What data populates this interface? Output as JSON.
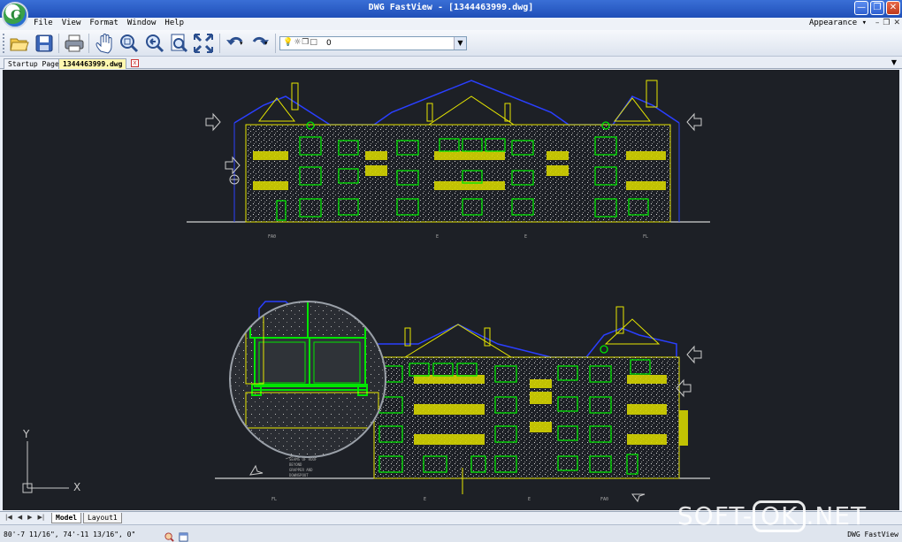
{
  "window": {
    "title": "DWG FastView - [1344463999.dwg]",
    "minimize_icon": "minimize-icon",
    "maximize_icon": "restore-icon",
    "close_icon": "close-icon"
  },
  "menu": {
    "items": [
      "File",
      "View",
      "Format",
      "Window",
      "Help"
    ],
    "appearance": "Appearance ▾"
  },
  "toolbar": {
    "tools": [
      "open-icon",
      "save-icon",
      "print-icon",
      "pan-icon",
      "zoom-window-icon",
      "zoom-previous-icon",
      "zoom-realtime-icon",
      "zoom-extents-icon",
      "undo-icon",
      "redo-icon"
    ],
    "layer_icons": "💡☼❐□",
    "layer_value": "0"
  },
  "tabs": {
    "startup": "Startup Page",
    "file": "1344463999.dwg",
    "close": "x"
  },
  "layout": {
    "nav": [
      "|◀",
      "◀",
      "▶",
      "▶|"
    ],
    "model": "Model",
    "layout1": "Layout1"
  },
  "drawing": {
    "ucs_x": "X",
    "ucs_y": "Y",
    "note_lines": [
      "PANEL",
      "SEAMS OF ROOF",
      "BEYOND",
      "GRAPPER AND",
      "DOWNSPOUT"
    ],
    "grid_labels_top": [
      "FA0",
      "E",
      "E",
      "FL"
    ],
    "grid_labels_bottom": [
      "FL",
      "E",
      "E",
      "FA0"
    ]
  },
  "status": {
    "coords": "80'-7 11/16\", 74'-11 13/16\", 0\"",
    "app": "DWG FastView"
  },
  "watermark": {
    "left": "SOFT-",
    "ok": "OK",
    "right": ".NET"
  }
}
